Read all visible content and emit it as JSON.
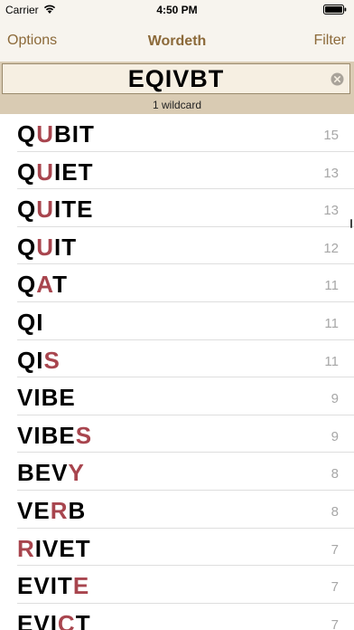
{
  "status_bar": {
    "carrier": "Carrier",
    "time": "4:50 PM",
    "icons": [
      "wifi-icon",
      "battery-icon"
    ]
  },
  "nav": {
    "left_label": "Options",
    "title": "Wordeth",
    "right_label": "Filter"
  },
  "search": {
    "value": "EQIVBT",
    "wildcard_text": "1 wildcard",
    "clear_icon": "clear-icon"
  },
  "colors": {
    "accent": "#8c6a3a",
    "wildcard_letter": "#a8454e",
    "search_band": "#d9cbb3",
    "score": "#a7a7a7"
  },
  "words": [
    {
      "letters": [
        {
          "c": "Q",
          "wild": false
        },
        {
          "c": "U",
          "wild": true
        },
        {
          "c": "B",
          "wild": false
        },
        {
          "c": "I",
          "wild": false
        },
        {
          "c": "T",
          "wild": false
        }
      ],
      "score": "15"
    },
    {
      "letters": [
        {
          "c": "Q",
          "wild": false
        },
        {
          "c": "U",
          "wild": true
        },
        {
          "c": "I",
          "wild": false
        },
        {
          "c": "E",
          "wild": false
        },
        {
          "c": "T",
          "wild": false
        }
      ],
      "score": "13"
    },
    {
      "letters": [
        {
          "c": "Q",
          "wild": false
        },
        {
          "c": "U",
          "wild": true
        },
        {
          "c": "I",
          "wild": false
        },
        {
          "c": "T",
          "wild": false
        },
        {
          "c": "E",
          "wild": false
        }
      ],
      "score": "13"
    },
    {
      "letters": [
        {
          "c": "Q",
          "wild": false
        },
        {
          "c": "U",
          "wild": true
        },
        {
          "c": "I",
          "wild": false
        },
        {
          "c": "T",
          "wild": false
        }
      ],
      "score": "12"
    },
    {
      "letters": [
        {
          "c": "Q",
          "wild": false
        },
        {
          "c": "A",
          "wild": true
        },
        {
          "c": "T",
          "wild": false
        }
      ],
      "score": "11"
    },
    {
      "letters": [
        {
          "c": "Q",
          "wild": false
        },
        {
          "c": "I",
          "wild": false
        }
      ],
      "score": "11"
    },
    {
      "letters": [
        {
          "c": "Q",
          "wild": false
        },
        {
          "c": "I",
          "wild": false
        },
        {
          "c": "S",
          "wild": true
        }
      ],
      "score": "11"
    },
    {
      "letters": [
        {
          "c": "V",
          "wild": false
        },
        {
          "c": "I",
          "wild": false
        },
        {
          "c": "B",
          "wild": false
        },
        {
          "c": "E",
          "wild": false
        }
      ],
      "score": "9"
    },
    {
      "letters": [
        {
          "c": "V",
          "wild": false
        },
        {
          "c": "I",
          "wild": false
        },
        {
          "c": "B",
          "wild": false
        },
        {
          "c": "E",
          "wild": false
        },
        {
          "c": "S",
          "wild": true
        }
      ],
      "score": "9"
    },
    {
      "letters": [
        {
          "c": "B",
          "wild": false
        },
        {
          "c": "E",
          "wild": false
        },
        {
          "c": "V",
          "wild": false
        },
        {
          "c": "Y",
          "wild": true
        }
      ],
      "score": "8"
    },
    {
      "letters": [
        {
          "c": "V",
          "wild": false
        },
        {
          "c": "E",
          "wild": false
        },
        {
          "c": "R",
          "wild": true
        },
        {
          "c": "B",
          "wild": false
        }
      ],
      "score": "8"
    },
    {
      "letters": [
        {
          "c": "R",
          "wild": true
        },
        {
          "c": "I",
          "wild": false
        },
        {
          "c": "V",
          "wild": false
        },
        {
          "c": "E",
          "wild": false
        },
        {
          "c": "T",
          "wild": false
        }
      ],
      "score": "7"
    },
    {
      "letters": [
        {
          "c": "E",
          "wild": false
        },
        {
          "c": "V",
          "wild": false
        },
        {
          "c": "I",
          "wild": false
        },
        {
          "c": "T",
          "wild": false
        },
        {
          "c": "E",
          "wild": true
        }
      ],
      "score": "7"
    },
    {
      "letters": [
        {
          "c": "E",
          "wild": false
        },
        {
          "c": "V",
          "wild": false
        },
        {
          "c": "I",
          "wild": false
        },
        {
          "c": "C",
          "wild": true
        },
        {
          "c": "T",
          "wild": false
        }
      ],
      "score": "7"
    }
  ]
}
